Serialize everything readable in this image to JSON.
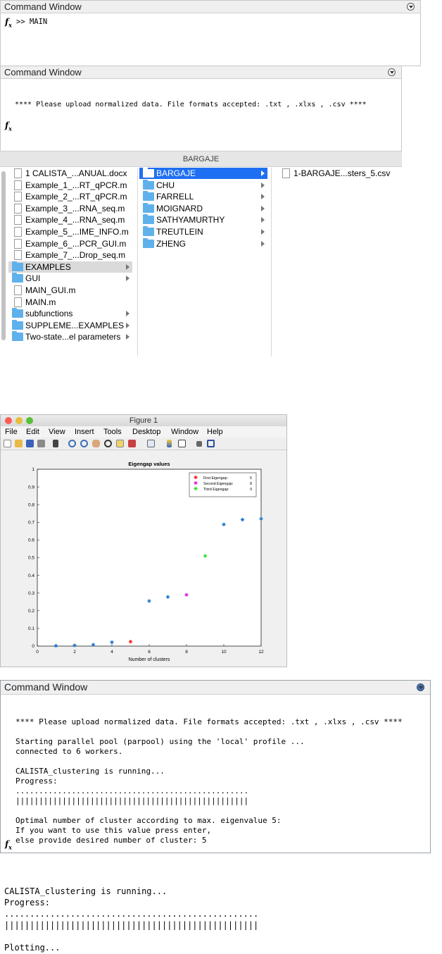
{
  "cw1": {
    "title": "Command Window",
    "prompt": ">> MAIN"
  },
  "cw2": {
    "title": "Command Window",
    "message": "**** Please upload normalized data. File formats accepted: .txt , .xlxs , .csv ****"
  },
  "finder": {
    "title": "BARGAJE",
    "col1": [
      {
        "label": "1 CALISTA_...ANUAL.docx",
        "kind": "doc",
        "arrow": false
      },
      {
        "label": "Example_1_...RT_qPCR.m",
        "kind": "doc",
        "arrow": false
      },
      {
        "label": "Example_2_...RT_qPCR.m",
        "kind": "doc",
        "arrow": false
      },
      {
        "label": "Example_3_...RNA_seq.m",
        "kind": "doc",
        "arrow": false
      },
      {
        "label": "Example_4_...RNA_seq.m",
        "kind": "doc",
        "arrow": false
      },
      {
        "label": "Example_5_...IME_INFO.m",
        "kind": "doc",
        "arrow": false
      },
      {
        "label": "Example_6_...PCR_GUI.m",
        "kind": "doc",
        "arrow": false
      },
      {
        "label": "Example_7_...Drop_seq.m",
        "kind": "doc",
        "arrow": false
      },
      {
        "label": "EXAMPLES",
        "kind": "folder",
        "arrow": true,
        "state": "gsel"
      },
      {
        "label": "GUI",
        "kind": "folder",
        "arrow": true
      },
      {
        "label": "MAIN_GUI.m",
        "kind": "doc",
        "arrow": false
      },
      {
        "label": "MAIN.m",
        "kind": "doc",
        "arrow": false
      },
      {
        "label": "subfunctions",
        "kind": "folder",
        "arrow": true
      },
      {
        "label": "SUPPLEME...EXAMPLES",
        "kind": "folder",
        "arrow": true
      },
      {
        "label": "Two-state...el parameters",
        "kind": "folder",
        "arrow": true
      }
    ],
    "col2": [
      {
        "label": "BARGAJE",
        "kind": "folder",
        "arrow": true,
        "state": "sel"
      },
      {
        "label": "CHU",
        "kind": "folder",
        "arrow": true
      },
      {
        "label": "FARRELL",
        "kind": "folder",
        "arrow": true
      },
      {
        "label": "MOIGNARD",
        "kind": "folder",
        "arrow": true
      },
      {
        "label": "SATHYAMURTHY",
        "kind": "folder",
        "arrow": true
      },
      {
        "label": "TREUTLEIN",
        "kind": "folder",
        "arrow": true
      },
      {
        "label": "ZHENG",
        "kind": "folder",
        "arrow": true
      }
    ],
    "col3": [
      {
        "label": "1-BARGAJE...sters_5.csv",
        "kind": "doc",
        "arrow": false
      }
    ]
  },
  "figure": {
    "window_title": "Figure 1",
    "menu": [
      "File",
      "Edit",
      "View",
      "Insert",
      "Tools",
      "Desktop",
      "Window",
      "Help"
    ],
    "colors": {
      "blue": "#1f77d4",
      "red": "#ff2020",
      "magenta": "#e020e0",
      "green": "#30e030"
    }
  },
  "chart_data": {
    "type": "scatter",
    "title": "Eigengap values",
    "xlabel": "Number of clusters",
    "ylabel": "",
    "xlim": [
      0,
      12
    ],
    "ylim": [
      0,
      1
    ],
    "xticks": [
      0,
      2,
      4,
      6,
      8,
      10,
      12
    ],
    "yticks": [
      0,
      0.1,
      0.2,
      0.3,
      0.4,
      0.5,
      0.6,
      0.7,
      0.8,
      0.9,
      1
    ],
    "grid": false,
    "legend_position": "top-right",
    "series": [
      {
        "name": "",
        "color": "#1f77d4",
        "x": [
          1,
          2,
          3,
          4,
          6,
          7,
          10,
          11,
          12
        ],
        "y": [
          0.002,
          0.004,
          0.008,
          0.022,
          0.255,
          0.278,
          0.688,
          0.715,
          0.72
        ]
      },
      {
        "name": "First Eigengap:",
        "legend_value": "5",
        "color": "#ff2020",
        "x": [
          5
        ],
        "y": [
          0.025
        ]
      },
      {
        "name": "Second Eigengap:",
        "legend_value": "8",
        "color": "#e020e0",
        "x": [
          8
        ],
        "y": [
          0.29
        ]
      },
      {
        "name": "Third Eigengap:",
        "legend_value": "9",
        "color": "#30e030",
        "x": [
          9
        ],
        "y": [
          0.51
        ]
      }
    ]
  },
  "cw3": {
    "title": "Command Window",
    "lines": [
      "**** Please upload normalized data. File formats accepted: .txt , .xlxs , .csv ****",
      "",
      "Starting parallel pool (parpool) using the 'local' profile ...",
      "connected to 6 workers.",
      "",
      "CALISTA_clustering is running...",
      "Progress:",
      "..................................................",
      "||||||||||||||||||||||||||||||||||||||||||||||||||",
      "",
      "Optimal number of cluster according to max. eigenvalue 5:",
      "If you want to use this value press enter,",
      "else provide desired number of cluster: 5"
    ]
  },
  "cw4": {
    "lines": [
      "CALISTA_clustering is running...",
      "Progress:",
      "..................................................",
      "||||||||||||||||||||||||||||||||||||||||||||||||||",
      "",
      "Plotting..."
    ]
  }
}
